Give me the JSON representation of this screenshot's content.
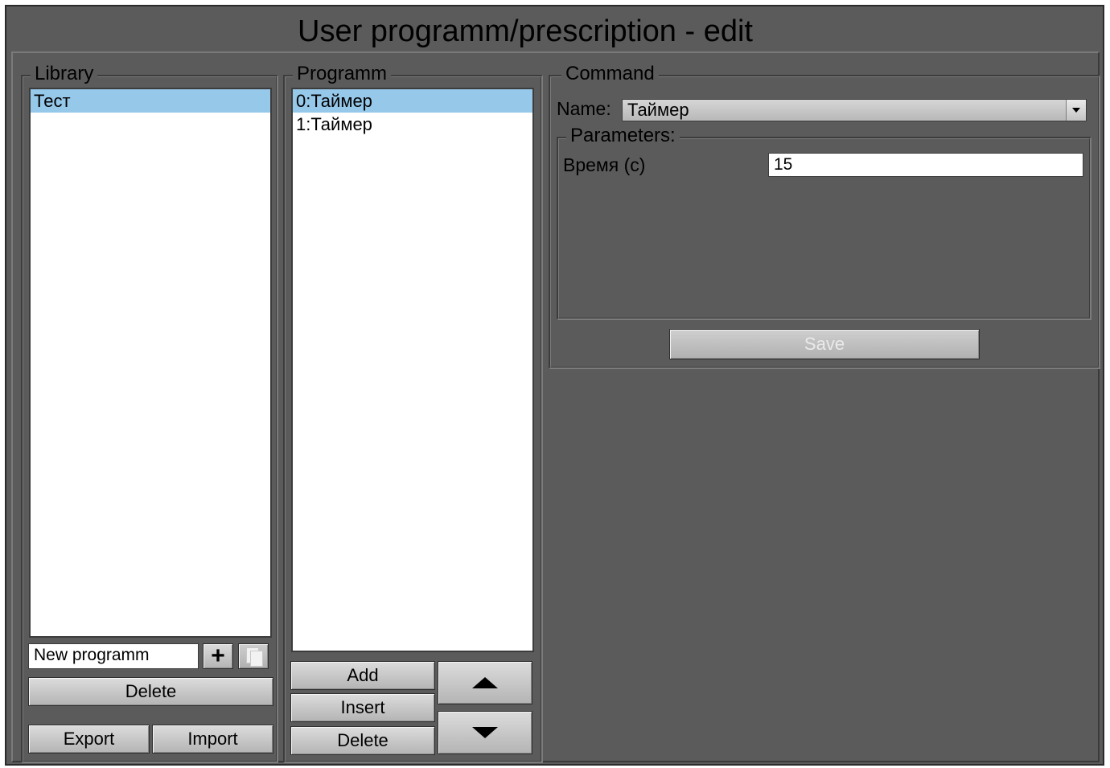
{
  "window": {
    "title": "User programm/prescription - edit"
  },
  "library": {
    "legend": "Library",
    "items": [
      {
        "label": "Тест",
        "selected": true
      }
    ],
    "new_name": {
      "value": "New programm"
    },
    "add_icon": "plus-icon",
    "copy_icon": "copy-icon",
    "delete_label": "Delete",
    "export_label": "Export",
    "import_label": "Import"
  },
  "programm": {
    "legend": "Programm",
    "items": [
      {
        "label": "0:Таймер",
        "selected": true
      },
      {
        "label": "1:Таймер",
        "selected": false
      }
    ],
    "add_label": "Add",
    "insert_label": "Insert",
    "delete_label": "Delete",
    "up_icon": "arrow-up-icon",
    "down_icon": "arrow-down-icon"
  },
  "command": {
    "legend": "Command",
    "name_label": "Name:",
    "name_value": "Таймер",
    "parameters_legend": "Parameters:",
    "parameters": [
      {
        "label": "Время (с)",
        "value": "15"
      }
    ],
    "save_label": "Save"
  },
  "colors": {
    "background": "#5b5b5b",
    "selection": "#96c8ea"
  }
}
